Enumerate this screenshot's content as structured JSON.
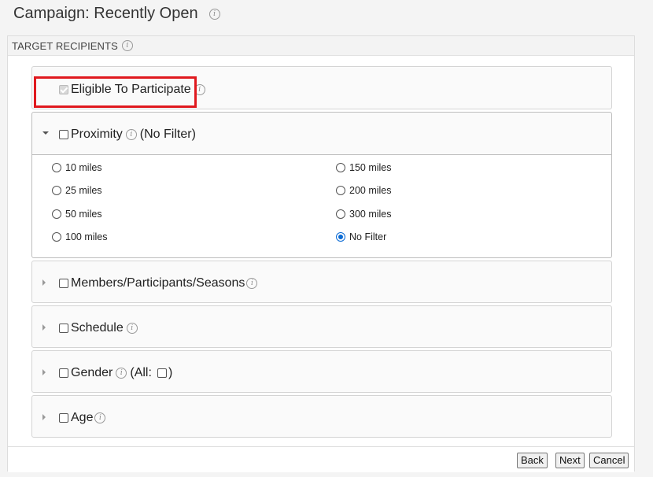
{
  "page": {
    "title": "Campaign: Recently Open",
    "info_glyph": "i"
  },
  "panel": {
    "header": "TARGET RECIPIENTS"
  },
  "sections": {
    "eligible": {
      "label": "Eligible To Participate",
      "checked": true,
      "disabled": true
    },
    "proximity": {
      "label": "Proximity",
      "suffix": "(No Filter)",
      "expanded": true,
      "options_left": [
        "10 miles",
        "25 miles",
        "50 miles",
        "100 miles"
      ],
      "options_right": [
        "150 miles",
        "200 miles",
        "300 miles",
        "No Filter"
      ],
      "selected": "No Filter"
    },
    "members": {
      "label": "Members/Participants/Seasons"
    },
    "schedule": {
      "label": "Schedule"
    },
    "gender": {
      "label": "Gender",
      "all_prefix": "(All:",
      "all_suffix": ")"
    },
    "age": {
      "label": "Age"
    }
  },
  "footer": {
    "back": "Back",
    "next": "Next",
    "cancel": "Cancel"
  },
  "colors": {
    "highlight": "#e0191e",
    "radio_selected": "#0a6ad4"
  }
}
